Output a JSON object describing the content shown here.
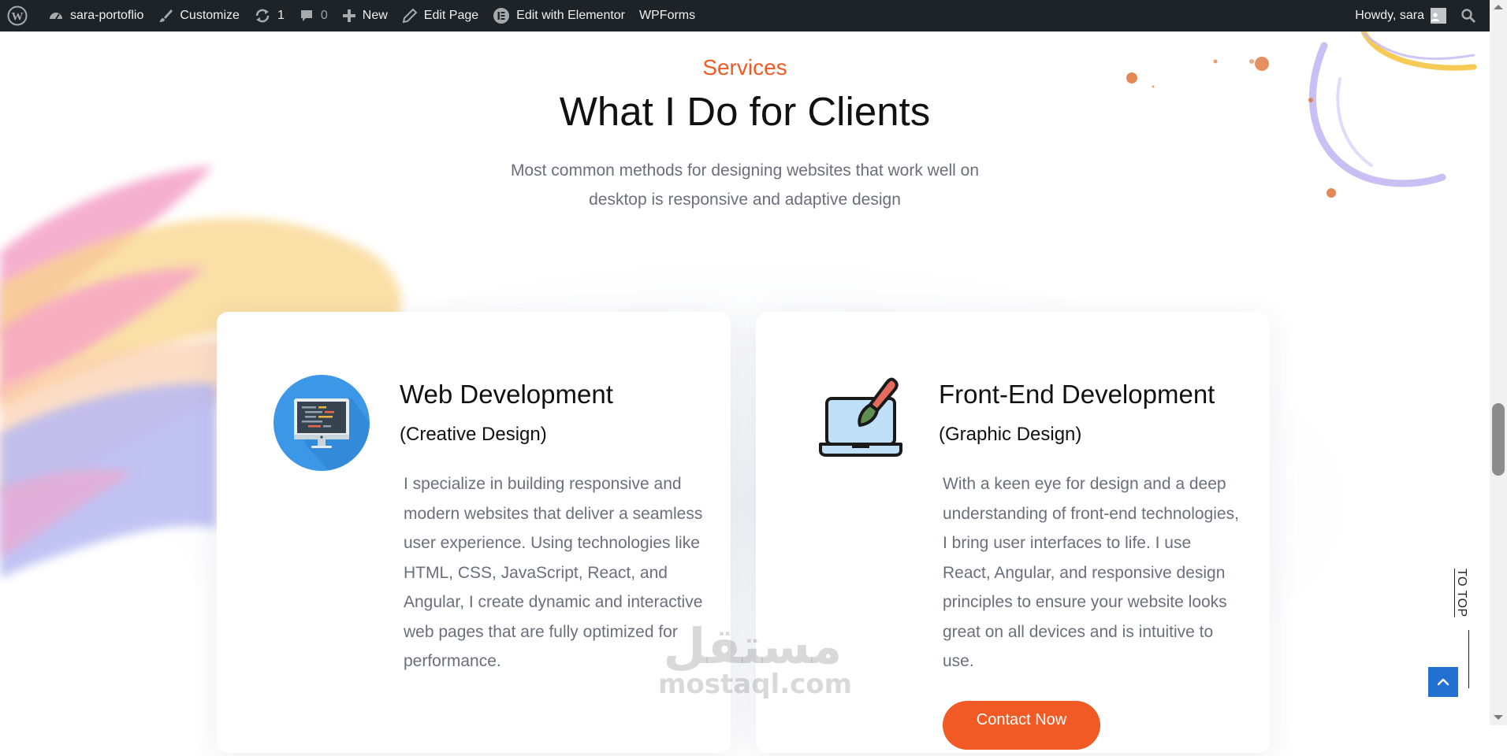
{
  "admin_bar": {
    "site_name": "sara-portoflio",
    "customize": "Customize",
    "updates_count": "1",
    "comments_count": "0",
    "new": "New",
    "edit_page": "Edit Page",
    "edit_elementor": "Edit with Elementor",
    "wpforms": "WPForms",
    "howdy": "Howdy, sara"
  },
  "section": {
    "label": "Services",
    "title": "What I Do for Clients",
    "description": "Most common methods for designing websites that work well on desktop is responsive and adaptive design"
  },
  "cards": [
    {
      "title": "Web Development",
      "subtitle": "(Creative Design)",
      "text": "I specialize in building responsive and modern websites that deliver a seamless user experience. Using technologies like HTML, CSS, JavaScript, React, and Angular, I create dynamic and interactive web pages that are fully optimized for performance.",
      "icon": "desktop-code-icon"
    },
    {
      "title": "Front-End Development",
      "subtitle": "(Graphic Design)",
      "text": "With a keen eye for design and a deep understanding of front-end technologies, I bring user interfaces to life. I use React, Angular, and responsive design principles to ensure your website looks great on all devices and is intuitive to use.",
      "button": "Contact Now",
      "icon": "laptop-paintbrush-icon"
    }
  ],
  "to_top": "TO TOP",
  "watermark": {
    "arabic": "مستقل",
    "latin": "mostaql.com"
  },
  "colors": {
    "accent": "#f15a24",
    "admin_bar": "#1d2327",
    "to_top_button": "#2271d1",
    "body_text": "#6a6f7a"
  }
}
